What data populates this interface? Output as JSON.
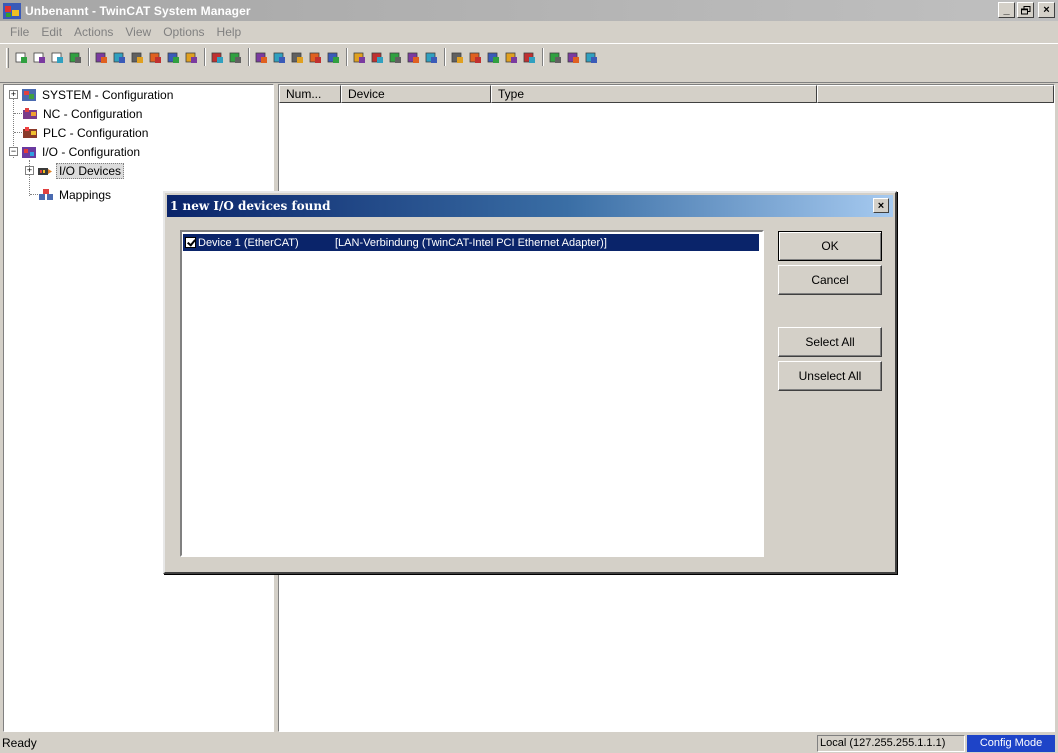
{
  "window": {
    "title": "Unbenannt - TwinCAT System Manager",
    "minimize": "_",
    "restore": "▫",
    "close": "×"
  },
  "menu": [
    "File",
    "Edit",
    "Actions",
    "View",
    "Options",
    "Help"
  ],
  "toolbar": {
    "icons": [
      "new-icon",
      "open-icon",
      "open-folder-icon",
      "save-icon",
      "print-icon",
      "print-preview-icon",
      "cut-icon",
      "copy-icon",
      "paste-icon",
      "paste-special-icon",
      "find-icon",
      "find-next-icon",
      "target-system-icon",
      "build-icon",
      "check-icon",
      "activate-icon",
      "restart-icon",
      "config-mode-icon",
      "reload-icon",
      "scan-icon",
      "toggle-icon",
      "mapping-icon",
      "zoom-icon",
      "scope-icon",
      "variables-icon",
      "online-icon",
      "force-icon",
      "watch-icon",
      "info-icon",
      "help-icon"
    ]
  },
  "tree": {
    "items": [
      {
        "label": "SYSTEM - Configuration",
        "icon": "system-icon",
        "expander": "+"
      },
      {
        "label": "NC - Configuration",
        "icon": "nc-icon"
      },
      {
        "label": "PLC - Configuration",
        "icon": "plc-icon"
      },
      {
        "label": "I/O - Configuration",
        "icon": "io-icon",
        "expander": "−"
      },
      {
        "label": "I/O Devices",
        "icon": "io-devices-icon",
        "expander": "+"
      },
      {
        "label": "Mappings",
        "icon": "mappings-icon"
      }
    ]
  },
  "listview": {
    "columns": [
      "Num...",
      "Device",
      "Type",
      ""
    ]
  },
  "dialog": {
    "title": "1 new I/O devices found",
    "close": "×",
    "device": {
      "name": "Device 1 (EtherCAT)",
      "adapter": "[LAN-Verbindung (TwinCAT-Intel PCI Ethernet Adapter)]",
      "checked": true
    },
    "buttons": {
      "ok": "OK",
      "cancel": "Cancel",
      "select_all": "Select All",
      "unselect_all": "Unselect All"
    }
  },
  "status": {
    "left": "Ready",
    "target": "Local (127.255.255.1.1.1)",
    "mode": "Config Mode"
  },
  "colors": {
    "selection": "#0a246a",
    "config_mode": "#1e44c8",
    "dialog_title_start": "#0a246a",
    "dialog_title_end": "#a6caf0"
  }
}
